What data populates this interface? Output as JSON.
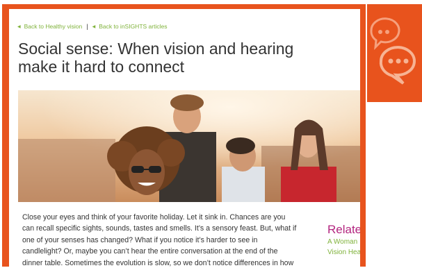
{
  "breadcrumbs": [
    {
      "label": "Back to Healthy vision"
    },
    {
      "label": "Back to inSIGHTS articles"
    }
  ],
  "separator": "|",
  "article": {
    "title_line1": "Social sense: When vision and hearing",
    "title_line2": "make it hard to connect",
    "body_lines": [
      "Close your eyes and think of your favorite holiday. Let it sink in.  Chances are you",
      "can recall specific sights, sounds, tastes and smells. It’s a sensory feast. But, what if",
      "one of your senses has changed? What if you notice it’s harder to see in",
      "candlelight? Or, maybe you can’t hear the entire conversation at the end of the",
      "dinner table. Sometimes the evolution is slow, so we don’t notice differences in how"
    ]
  },
  "related": {
    "title": "Related",
    "links": [
      "A Woman",
      "Vision Hea"
    ]
  },
  "colors": {
    "accent_orange": "#e8531d",
    "link_green": "#7fb23a",
    "related_magenta": "#b3257f",
    "text_dark": "#333333"
  },
  "icons": {
    "side_tile": "chat-bubbles-icon",
    "breadcrumb_arrow": "chevron-left-icon"
  }
}
